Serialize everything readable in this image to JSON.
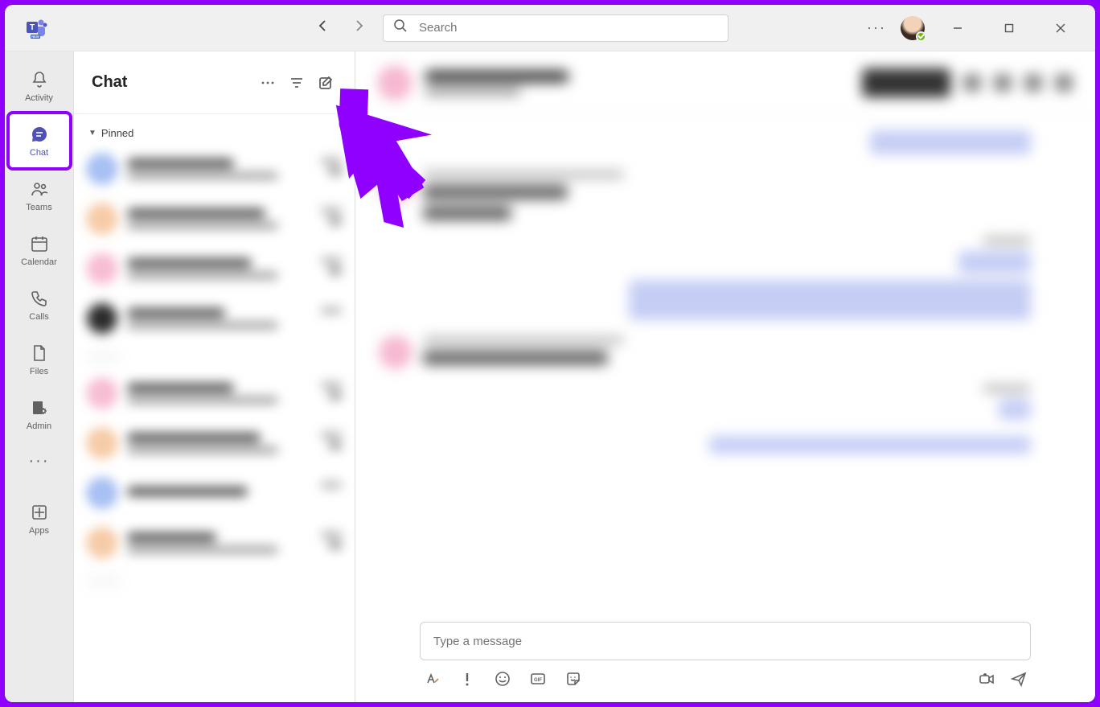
{
  "search": {
    "placeholder": "Search"
  },
  "rail": {
    "items": [
      {
        "label": "Activity"
      },
      {
        "label": "Chat"
      },
      {
        "label": "Teams"
      },
      {
        "label": "Calendar"
      },
      {
        "label": "Calls"
      },
      {
        "label": "Files"
      },
      {
        "label": "Admin"
      }
    ],
    "apps_label": "Apps"
  },
  "panel": {
    "title": "Chat",
    "pinned_label": "Pinned"
  },
  "compose": {
    "placeholder": "Type a message"
  },
  "icons": {
    "more": "more-icon",
    "filter": "filter-icon",
    "new_chat": "compose-icon",
    "search": "search-icon",
    "back": "chevron-left-icon",
    "forward": "chevron-right-icon",
    "minimize": "minimize-icon",
    "maximize": "maximize-icon",
    "close": "close-icon",
    "format": "format-icon",
    "priority": "priority-icon",
    "emoji": "emoji-icon",
    "gif": "gif-icon",
    "sticker": "sticker-icon",
    "meet": "video-icon",
    "send": "send-icon"
  },
  "colors": {
    "accent": "#4f52b2",
    "annotation": "#8f00ff"
  }
}
